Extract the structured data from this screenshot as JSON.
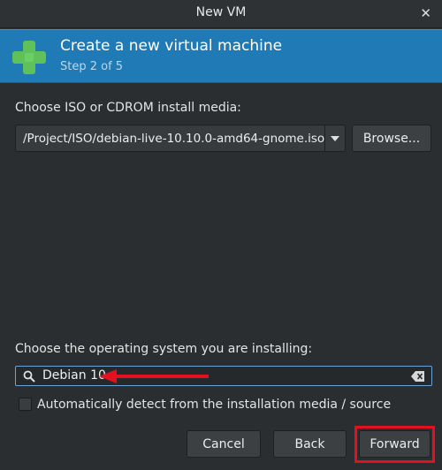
{
  "window": {
    "title": "New VM",
    "close_glyph": "✕"
  },
  "banner": {
    "heading": "Create a new virtual machine",
    "step": "Step 2 of 5",
    "icon": "green-plus-icon",
    "bg_color": "#1f7ab5"
  },
  "install_media": {
    "label": "Choose ISO or CDROM install media:",
    "iso_path": "/Project/ISO/debian-live-10.10.0-amd64-gnome.iso",
    "browse_label": "Browse..."
  },
  "os": {
    "label": "Choose the operating system you are installing:",
    "search_value": "Debian 10",
    "auto_detect_label": "Automatically detect from the installation media / source",
    "auto_detect_checked": false
  },
  "buttons": {
    "cancel": "Cancel",
    "back": "Back",
    "forward": "Forward"
  },
  "annotations": {
    "arrow_color": "#e3101f",
    "highlight_color": "#e3101f"
  }
}
